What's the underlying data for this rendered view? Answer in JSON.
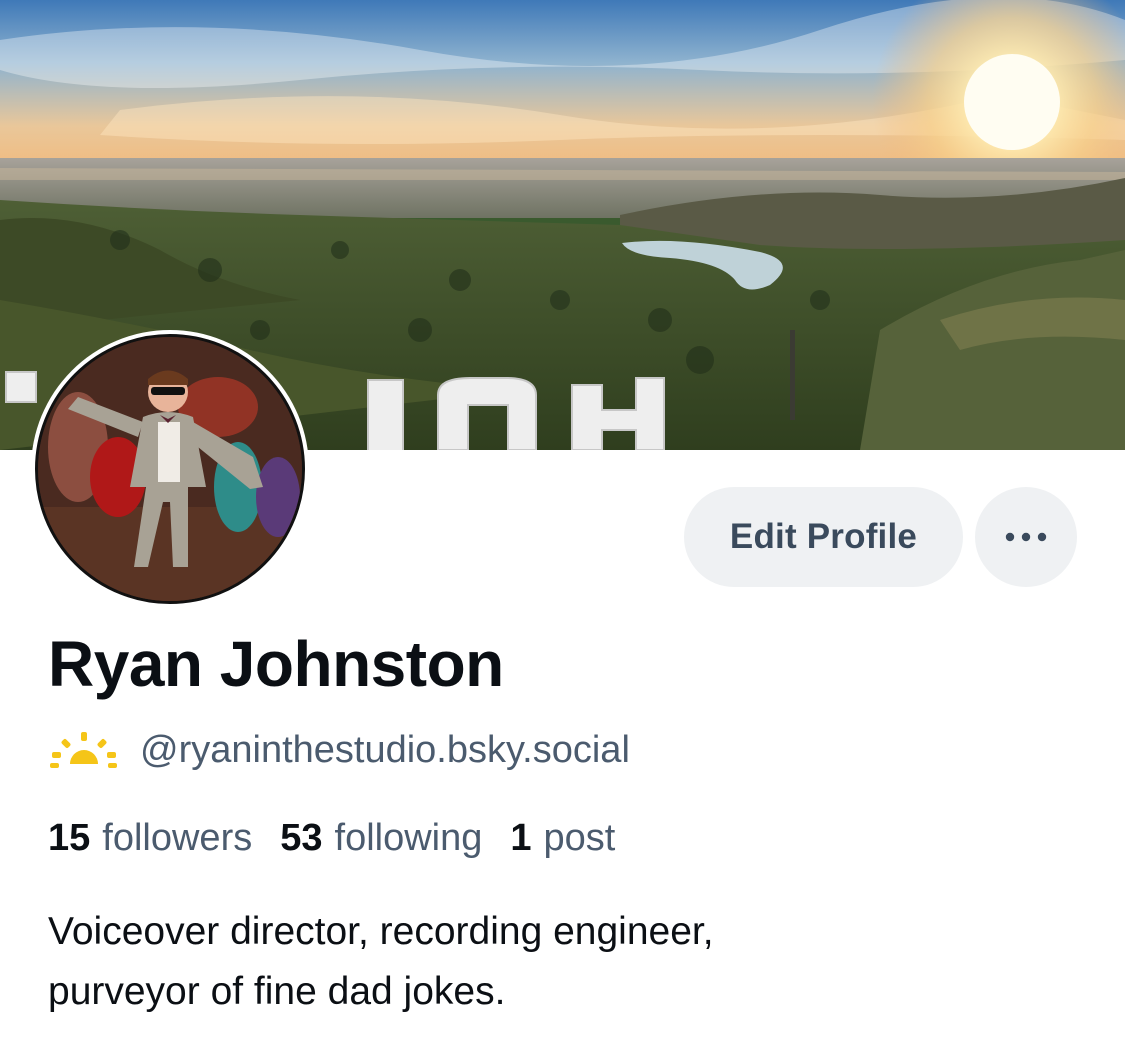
{
  "profile": {
    "display_name": "Ryan Johnston",
    "handle": "@ryaninthestudio.bsky.social",
    "handle_icon": "sunrise-icon",
    "bio_line1": "Voiceover director, recording engineer,",
    "bio_line2": "purveyor of fine dad jokes."
  },
  "actions": {
    "edit_label": "Edit Profile",
    "more_icon": "ellipsis-icon"
  },
  "stats": {
    "followers_count": "15",
    "followers_label": "followers",
    "following_count": "53",
    "following_label": "following",
    "posts_count": "1",
    "posts_label": "post"
  },
  "colors": {
    "accent_text": "#4b5b6e",
    "button_bg": "#eff1f3",
    "sun_icon": "#f5c518"
  }
}
